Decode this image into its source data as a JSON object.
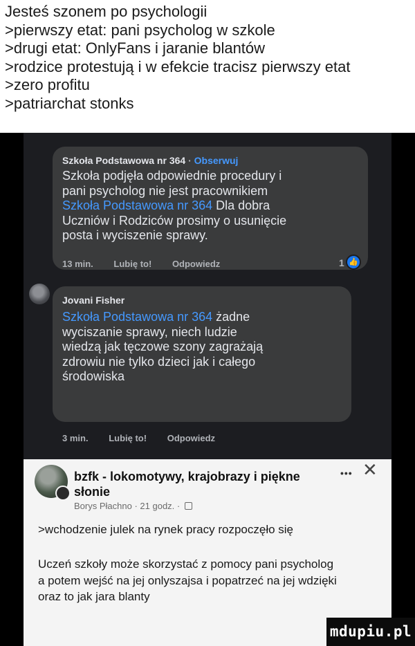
{
  "caption": {
    "lines": [
      "Jesteś szonem po psychologii",
      ">pierwszy etat: pani psycholog w szkole",
      ">drugi etat: OnlyFans i jaranie blantów",
      ">rodzice protestują i w efekcie tracisz pierwszy etat",
      ">zero profitu",
      ">patriarchat stonks"
    ]
  },
  "comments": [
    {
      "author": "Szkoła Podstawowa nr 364",
      "follow_label": "Obserwuj",
      "lines": [
        "Szkoła podjęła odpowiednie procedury i",
        "pani psycholog nie jest pracownikiem"
      ],
      "mention": "Szkoła Podstawowa nr 364",
      "mention_tail": " Dla dobra",
      "lines_after": [
        "Uczniów i Rodziców prosimy o usunięcie",
        "posta i wyciszenie sprawy."
      ],
      "time": "13 min.",
      "like_label": "Lubię to!",
      "reply_label": "Odpowiedz",
      "reaction_count": "1"
    },
    {
      "author": "Jovani Fisher",
      "mention": "Szkoła Podstawowa nr 364",
      "mention_tail": " żadne",
      "lines_after": [
        "wyciszanie sprawy, niech ludzie",
        "wiedzą jak tęczowe szony zagrażają",
        "zdrowiu nie tylko dzieci jak i całego",
        "środowiska"
      ],
      "time": "3 min.",
      "like_label": "Lubię to!",
      "reply_label": "Odpowiedz"
    }
  ],
  "group_post": {
    "title_lines": [
      "bzfk - lokomotywy, krajobrazy i piękne",
      "słonie"
    ],
    "more_label": "•••",
    "close_label": "✕",
    "author": "Borys Płachno",
    "time": "21 godz.",
    "paragraph1": ">wchodzenie julek na rynek pracy rozpoczęło się",
    "paragraph2_lines": [
      "Uczeń szkoły może skorzystać z pomocy pani psycholog",
      "a potem wejść na jej onlyszajsa i popatrzeć na jej wdzięki",
      "oraz to jak jara blanty"
    ]
  },
  "watermark": "mdupiu.pl",
  "colors": {
    "dark_bg": "#1c1d21",
    "bubble": "#3a3b3c",
    "link": "#4599ff",
    "reaction_blue": "#1877f2"
  },
  "icons": {
    "reaction": "thumbs-up-icon",
    "privacy": "globe-icon",
    "close": "close-icon",
    "more": "more-options-icon"
  }
}
